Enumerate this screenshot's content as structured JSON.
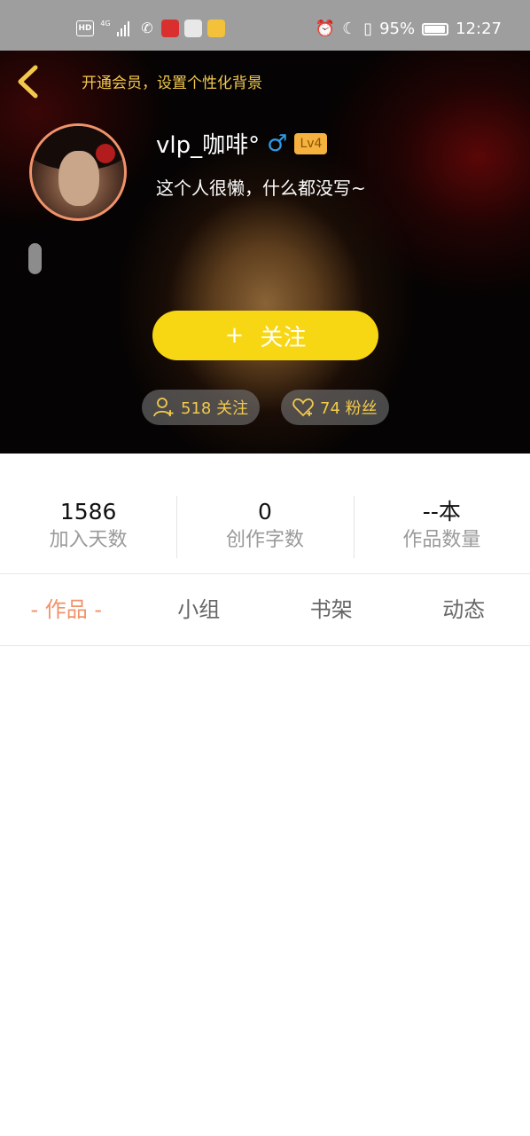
{
  "status_bar": {
    "hd": "HD",
    "network": "4G",
    "battery": "95%",
    "time": "12:27"
  },
  "header": {
    "vip_banner": "开通会员，设置个性化背景",
    "username": "vlp_咖啡°",
    "gender_symbol": "♂",
    "level": "Lv4",
    "bio": "这个人很懒，什么都没写~",
    "follow_label": "关注",
    "follow_plus": "+",
    "following_text": "518 关注",
    "fans_text": "74 粉丝"
  },
  "stats": [
    {
      "value": "1586",
      "label": "加入天数"
    },
    {
      "value": "0",
      "label": "创作字数"
    },
    {
      "value": "--本",
      "label": "作品数量"
    }
  ],
  "tabs": [
    {
      "label": "- 作品 -",
      "active": true
    },
    {
      "label": "小组",
      "active": false
    },
    {
      "label": "书架",
      "active": false
    },
    {
      "label": "动态",
      "active": false
    }
  ],
  "colors": {
    "accent_orange": "#f0936a",
    "follow_yellow": "#f7d613",
    "vip_gold": "#f2c94c",
    "level_badge": "#f6b23e",
    "gender_blue": "#2f9be6"
  }
}
